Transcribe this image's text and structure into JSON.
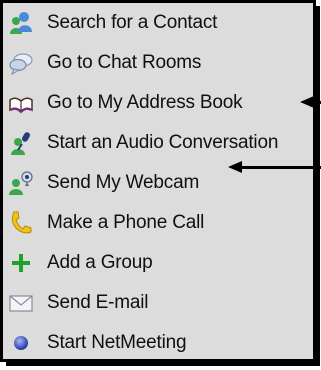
{
  "menu": {
    "items": [
      {
        "label": "Search for a Contact",
        "icon": "search-contact-icon"
      },
      {
        "label": "Go to Chat Rooms",
        "icon": "chat-rooms-icon"
      },
      {
        "label": "Go to My Address Book",
        "icon": "address-book-icon"
      },
      {
        "label": "Start an Audio Conversation",
        "icon": "audio-conversation-icon"
      },
      {
        "label": "Send My Webcam",
        "icon": "webcam-icon"
      },
      {
        "label": "Make a Phone Call",
        "icon": "phone-icon"
      },
      {
        "label": "Add a Group",
        "icon": "add-group-icon"
      },
      {
        "label": "Send E-mail",
        "icon": "email-icon"
      },
      {
        "label": "Start NetMeeting",
        "icon": "netmeeting-icon"
      }
    ]
  },
  "colors": {
    "menu_background": "#dcdcdc",
    "text": "#101010",
    "frame_border": "#000000",
    "annotation_arrow": "#000000"
  }
}
